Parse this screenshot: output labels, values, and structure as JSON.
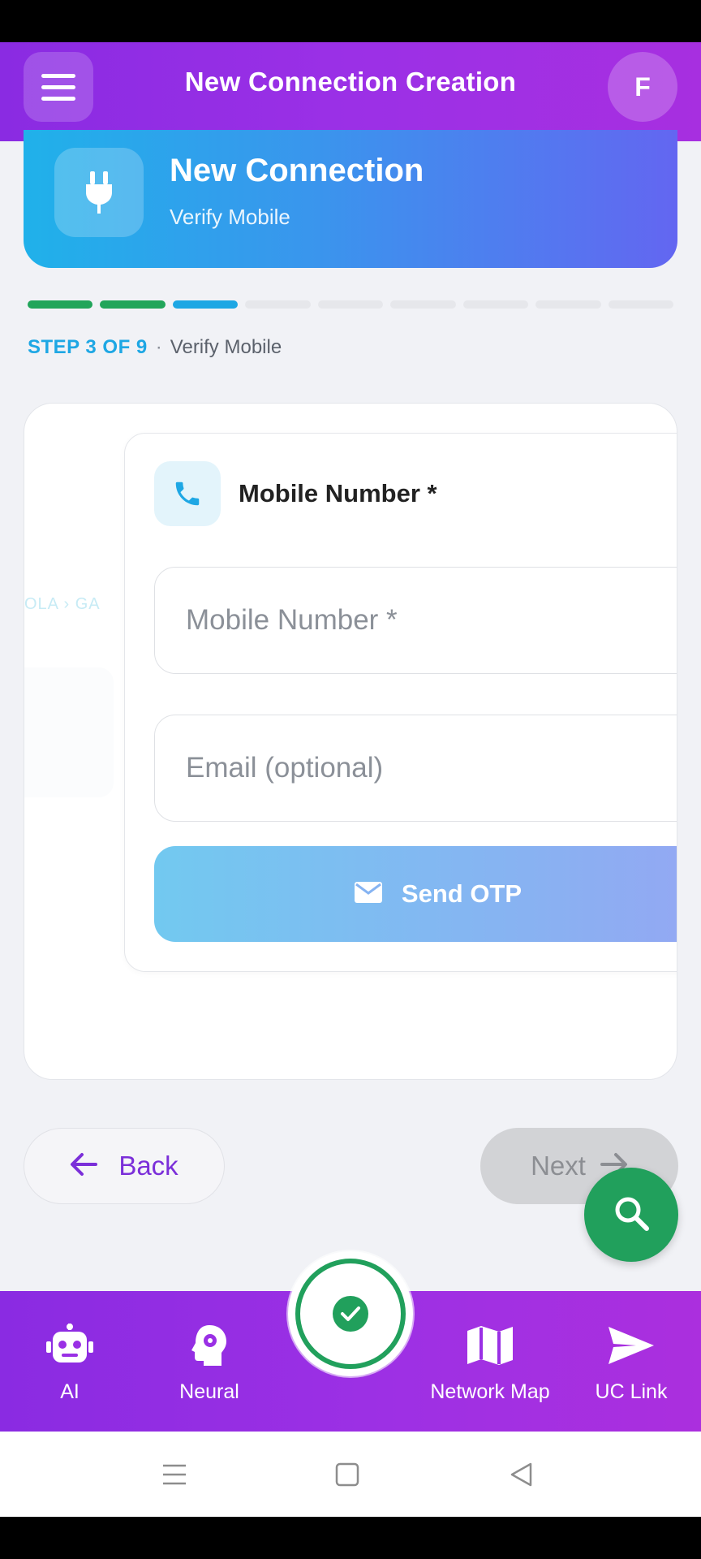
{
  "header": {
    "title": "New Connection Creation",
    "avatar_initial": "F",
    "menu_icon": "hamburger-menu-icon"
  },
  "hero": {
    "title": "New Connection",
    "subtitle": "Verify Mobile",
    "icon": "plug-icon"
  },
  "progress": {
    "total_steps": 9,
    "completed_steps": 2,
    "current_step": 3,
    "step_label": "STEP 3 OF 9",
    "separator": "·",
    "step_name": "Verify Mobile"
  },
  "form": {
    "field_title": "Mobile Number *",
    "field_icon": "phone-icon",
    "mobile_placeholder": "Mobile Number *",
    "mobile_value": "",
    "email_placeholder": "Email (optional)",
    "email_value": "",
    "send_otp_label": "Send OTP",
    "send_otp_icon": "mail-icon"
  },
  "ghost": {
    "crumb_text": "OLA  ›  GA"
  },
  "navigation": {
    "back_label": "Back",
    "next_label": "Next",
    "search_icon": "search-icon"
  },
  "bottom_nav": {
    "items": [
      {
        "label": "AI",
        "icon": "robot-icon"
      },
      {
        "label": "Neural",
        "icon": "brain-gear-icon"
      },
      {
        "label": "Network Map",
        "icon": "map-icon"
      },
      {
        "label": "UC Link",
        "icon": "send-icon"
      }
    ],
    "center_icon": "check-circle-icon"
  },
  "colors": {
    "brand_purple": "#8a2be2",
    "accent_blue": "#1ea7e4",
    "success_green": "#21a55a",
    "fab_green": "#21a05c",
    "back_text": "#7b2fd9"
  }
}
